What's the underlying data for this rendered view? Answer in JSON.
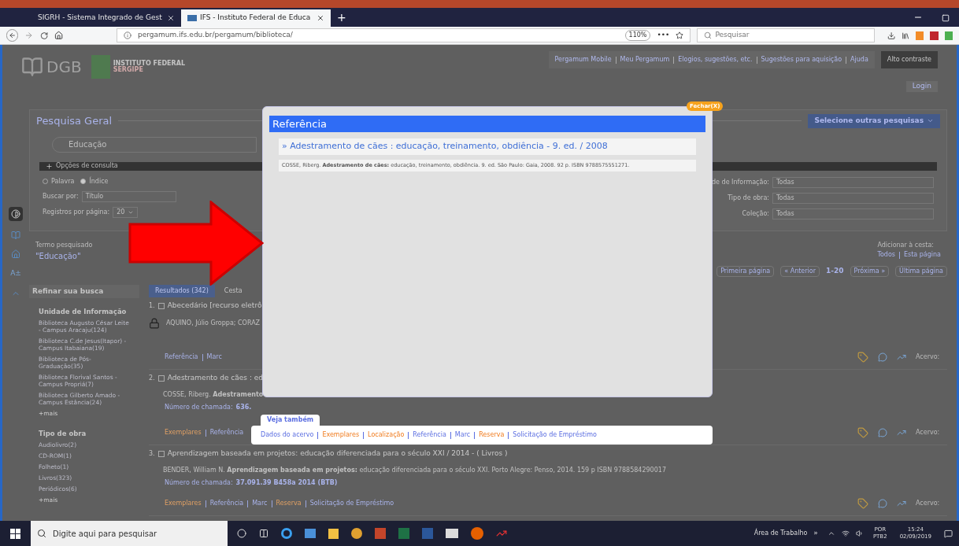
{
  "browser": {
    "tabs": [
      {
        "title": "SIGRH - Sistema Integrado de Gest",
        "selected": false
      },
      {
        "title": "IFS - Instituto Federal de Educa",
        "selected": true
      }
    ],
    "new_tab": "+",
    "url": "pergamum.ifs.edu.br/pergamum/biblioteca/",
    "zoom": "110%",
    "more": "•••",
    "search_placeholder": "Pesquisar"
  },
  "header": {
    "logo": "DGB",
    "institute": "INSTITUTO FEDERAL",
    "state": "SERGIPE",
    "links": [
      "Pergamum Mobile",
      "Meu Pergamum",
      "Elogios, sugestões, etc.",
      "Sugestões para aquisição",
      "Ajuda"
    ],
    "contrast_button": "Alto contraste",
    "login": "Login"
  },
  "side_tools": {
    "font_size": "A±"
  },
  "search_panel": {
    "title": "Pesquisa Geral",
    "other_searches": "Selecione outras pesquisas",
    "query": "Educação",
    "options_title": "Opções de consulta",
    "modes": [
      {
        "label": "Palavra",
        "selected": false
      },
      {
        "label": "Índice",
        "selected": true
      }
    ],
    "search_by_label": "Buscar por:",
    "search_by": "Título",
    "per_page_label": "Registros por página:",
    "per_page": "20",
    "filters": [
      {
        "label": "de de Informação:",
        "value": "Todas"
      },
      {
        "label": "Tipo de obra:",
        "value": "Todas"
      },
      {
        "label": "Coleção:",
        "value": "Todas"
      }
    ]
  },
  "searched": {
    "label": "Termo pesquisado",
    "term": "\"Educação\"",
    "basket_label": "Adicionar à cesta:",
    "basket_links": [
      "Todos",
      "Esta página"
    ]
  },
  "pagination": {
    "first": "Primeira página",
    "prev": "« Anterior",
    "range": "1-20",
    "next": "Próxima »",
    "last": "Última página"
  },
  "refine": {
    "title": "Refinar sua busca",
    "groups": [
      {
        "title": "Unidade de Informação",
        "items": [
          "Biblioteca Augusto César Leite - Campus Aracaju(124)",
          "Biblioteca C.de Jesus(Itapor) - Campus Itabaiana(19)",
          "Biblioteca de Pós-Graduação(35)",
          "Biblioteca Florival Santos - Campus Propriá(7)",
          "Biblioteca Gilberto Amado - Campus Estância(24)"
        ],
        "more": "+mais"
      },
      {
        "title": "Tipo de obra",
        "items": [
          "Audiolivro(2)",
          "CD-ROM(1)",
          "Folheto(1)",
          "Livros(323)",
          "Periódicos(6)"
        ],
        "more": "+mais"
      }
    ]
  },
  "result_tabs": [
    {
      "label": "Resultados (342)",
      "selected": true
    },
    {
      "label": "Cesta",
      "selected": false
    }
  ],
  "results": [
    {
      "number": "1.",
      "checked": false,
      "title": "Abecedário [recurso eletrô",
      "authors": "AQUINO, Júlio Groppa; CORAZ",
      "locked": true,
      "links": [
        {
          "label": "Referência",
          "kind": "info"
        },
        {
          "label": "Marc",
          "kind": "info"
        }
      ],
      "acervo": "Acervo:"
    },
    {
      "number": "2.",
      "checked": false,
      "title": "Adestramento de cães : ed",
      "authors": "COSSE, Riberg. **Adestramento**",
      "call_label": "Número de chamada:",
      "call_number": "636.",
      "locked": false,
      "links": [
        {
          "label": "Exemplares",
          "kind": "action"
        },
        {
          "label": "Referência",
          "kind": "info"
        }
      ],
      "acervo": "Acervo:"
    },
    {
      "number": "3.",
      "checked": false,
      "title": "Aprendizagem baseada em projetos: educação diferenciada para o século XXI / 2014 - ( Livros )",
      "authors": "BENDER, William N. **Aprendizagem baseada em projetos:** educação diferenciada para o século XXI. Porto Alegre: Penso, 2014. 159 p ISBN 9788584290017",
      "call_label": "Número de chamada:",
      "call_number": "37.091.39 B458a 2014 (BTB)",
      "locked": false,
      "links": [
        {
          "label": "Exemplares",
          "kind": "action"
        },
        {
          "label": "Referência",
          "kind": "info"
        },
        {
          "label": "Marc",
          "kind": "info"
        },
        {
          "label": "Reserva",
          "kind": "action"
        },
        {
          "label": "Solicitação de Empréstimo",
          "kind": "info"
        }
      ],
      "acervo": "Acervo:"
    }
  ],
  "modal": {
    "close": "Fechar(X)",
    "title": "Referência",
    "record_title": "» Adestramento de cães : educação, treinamento, obdiência - 9. ed. / 2008",
    "citation": "COSSE, Riberg. **Adestramento de cães:** educação, treinamento, obdiência. 9. ed. São Paulo: Gaia, 2008. 92 p. ISBN 9788575551271."
  },
  "see_also": {
    "title": "Veja também",
    "links": [
      {
        "label": "Dados do acervo",
        "kind": "info"
      },
      {
        "label": "Exemplares",
        "kind": "action"
      },
      {
        "label": "Localização",
        "kind": "action"
      },
      {
        "label": "Referência",
        "kind": "info"
      },
      {
        "label": "Marc",
        "kind": "info"
      },
      {
        "label": "Reserva",
        "kind": "action"
      },
      {
        "label": "Solicitação de Empréstimo",
        "kind": "info"
      }
    ]
  },
  "taskbar": {
    "search_placeholder": "Digite aqui para pesquisar",
    "desktop": "Área de Trabalho",
    "chevron": "»",
    "language": "POR",
    "layout": "PTB2",
    "time": "15:24",
    "date": "02/09/2019"
  }
}
